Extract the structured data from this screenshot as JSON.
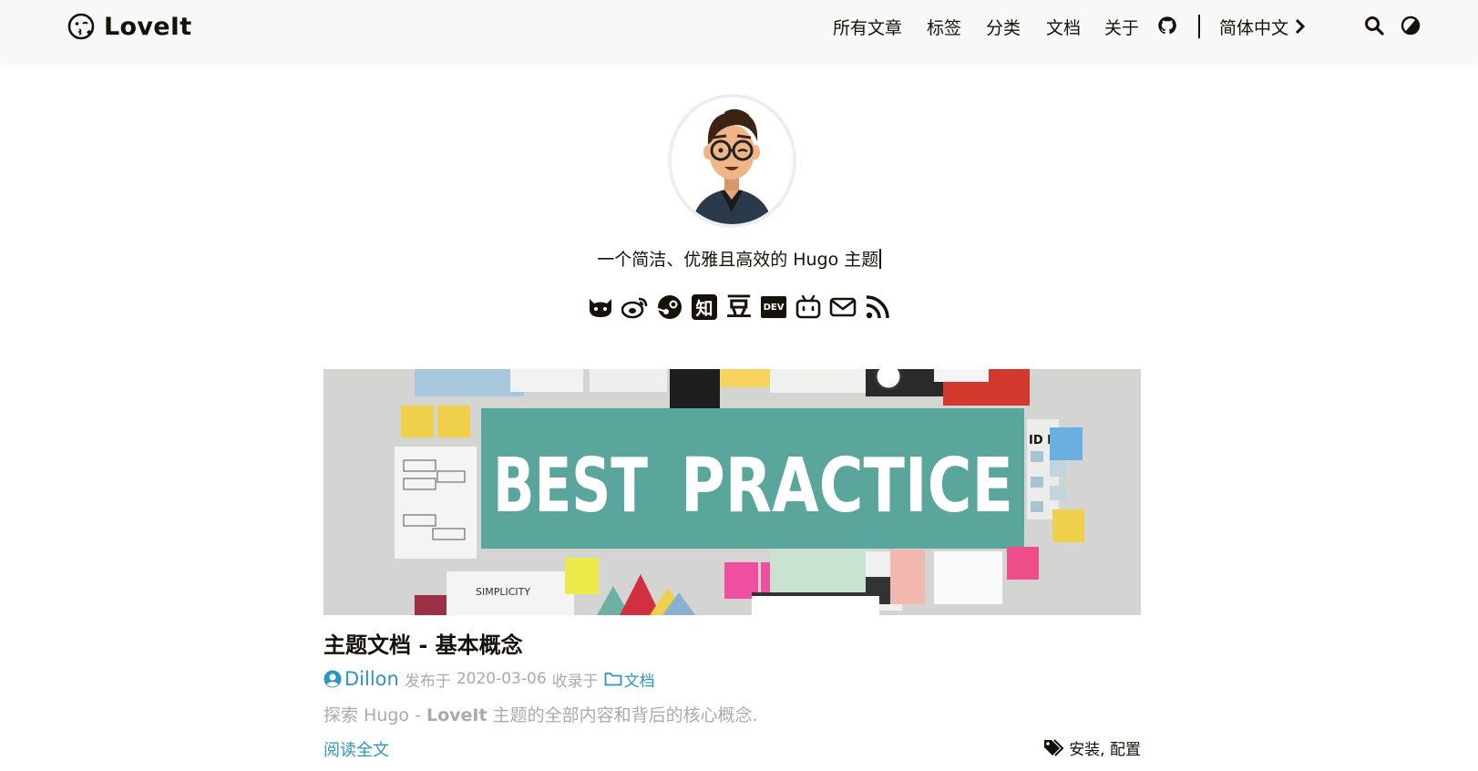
{
  "header": {
    "logo_text": "LoveIt",
    "nav": {
      "all_posts": "所有文章",
      "tags": "标签",
      "categories": "分类",
      "docs": "文档",
      "about": "关于",
      "language": "简体中文"
    }
  },
  "profile": {
    "subtitle": "一个简洁、优雅且高效的 Hugo 主题",
    "social_icons": [
      "github-icon",
      "weibo-icon",
      "steam-icon",
      "zhihu-icon",
      "douban-icon",
      "dev-icon",
      "bilibili-icon",
      "email-icon",
      "rss-icon"
    ],
    "zhihu_glyph": "知",
    "douban_glyph": "豆",
    "dev_glyph": "DEV"
  },
  "post": {
    "image_heading_1": "BEST",
    "image_heading_2": "PRACTICE",
    "image_small_text": "SIMPLICITY",
    "image_side_text": "ID EA",
    "title": "主题文档 - 基本概念",
    "author": "Dillon",
    "published_prefix": "发布于",
    "date": "2020-03-06",
    "category_prefix": "收录于",
    "category": "文档",
    "summary_prefix": "探索 Hugo - ",
    "summary_bold": "LoveIt",
    "summary_suffix": " 主题的全部内容和背后的核心概念.",
    "read_more": "阅读全文",
    "tags": "安装, 配置"
  },
  "colors": {
    "accent": "#2d96bd",
    "muted": "#a9a9b3",
    "text": "#161209",
    "header_bg": "#f8f8f8",
    "banner_teal": "#5aa69c"
  }
}
